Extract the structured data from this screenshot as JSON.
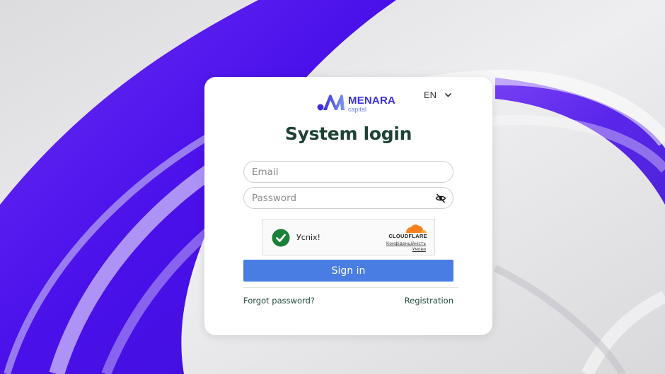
{
  "brand": {
    "name": "MENARA",
    "subtitle": "capital",
    "color": "#3a2fdd"
  },
  "language": {
    "code": "EN",
    "icon": "chevron-down-icon"
  },
  "form": {
    "title": "System login",
    "email_placeholder": "Email",
    "password_placeholder": "Password",
    "password_toggle_icon": "eye-off-icon",
    "submit_label": "Sign in",
    "submit_color": "#4a7de4"
  },
  "captcha": {
    "status": "Успіх!",
    "provider": "CLOUDFLARE",
    "privacy_link": "Конфіденційність",
    "terms_link": "Умови",
    "success_color": "#188038"
  },
  "links": {
    "forgot_password": "Forgot password?",
    "registration": "Registration"
  },
  "background": {
    "accent": "#5a1ef0"
  }
}
